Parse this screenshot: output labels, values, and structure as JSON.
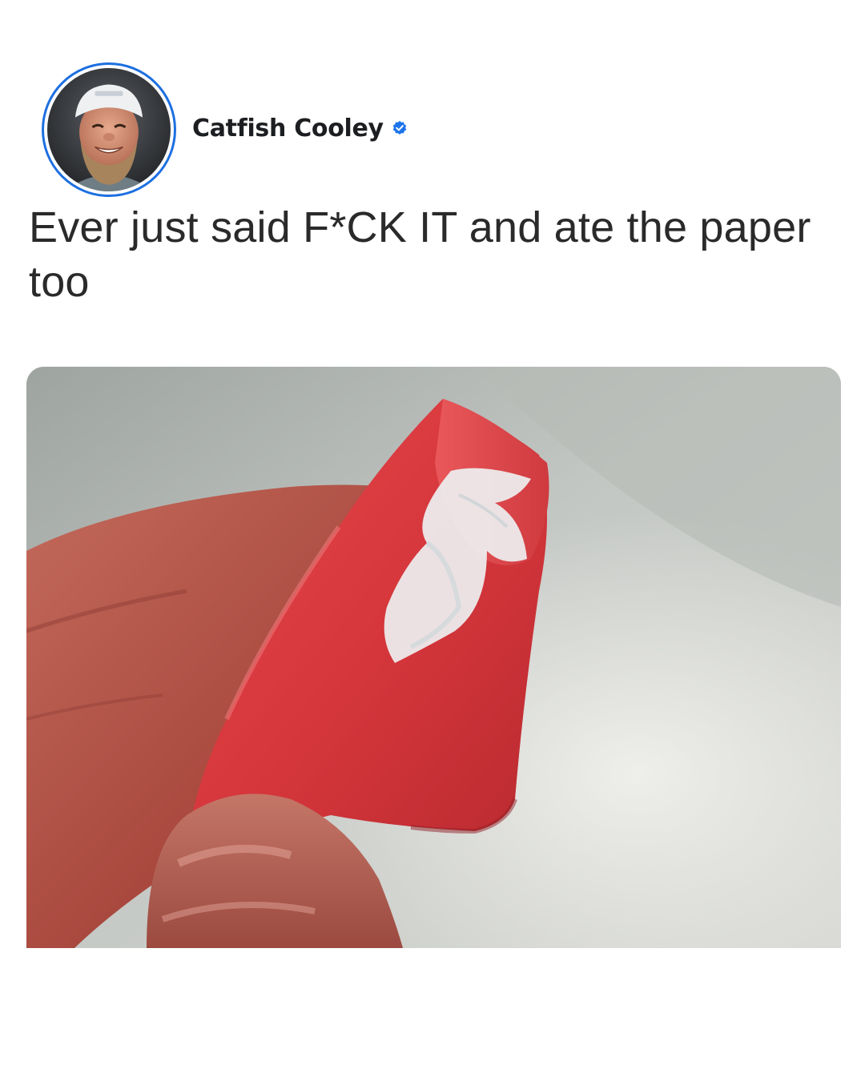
{
  "post": {
    "author": {
      "name": "Catfish Cooley",
      "verified": true,
      "avatar_icon": "profile-photo",
      "verified_icon": "verified-badge-icon"
    },
    "caption": "Ever just said F*CK IT and ate the paper too",
    "image": {
      "subject_icon": "candy-photo"
    }
  },
  "colors": {
    "ring": "#1d6fe0",
    "verified": "#1d74ea",
    "text": "#2a2a2a",
    "name": "#1c1e21",
    "candy": "#d93a3f"
  }
}
